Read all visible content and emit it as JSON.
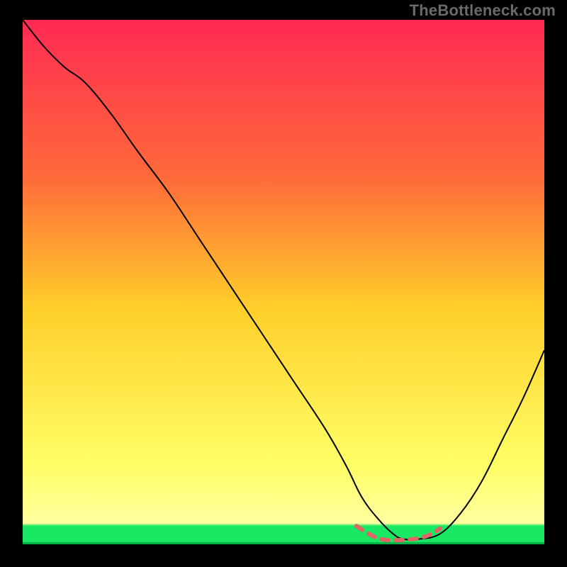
{
  "watermark": "TheBottleneck.com",
  "chart_data": {
    "type": "line",
    "title": "",
    "xlabel": "",
    "ylabel": "",
    "xlim": [
      0,
      100
    ],
    "ylim": [
      0,
      100
    ],
    "grid": false,
    "legend": false,
    "background_gradient": {
      "top": "#ff2a53",
      "mid_upper": "#ff6a3a",
      "mid": "#ffcf2a",
      "mid_lower": "#ffff66",
      "bottom_band": "#18e862",
      "bottom_line": "#00b44a"
    },
    "series": [
      {
        "name": "curve",
        "color": "#000000",
        "stroke_width": 2,
        "x": [
          0,
          4,
          8,
          12,
          17,
          22,
          28,
          34,
          40,
          46,
          52,
          58,
          62,
          65,
          68,
          71,
          73,
          76,
          80,
          84,
          88,
          92,
          96,
          100
        ],
        "y": [
          100,
          95,
          91,
          88,
          82,
          75,
          67,
          58,
          49,
          40,
          31,
          22,
          15,
          9,
          5,
          2,
          1,
          1,
          2,
          6,
          12,
          20,
          28,
          37
        ]
      },
      {
        "name": "dash-segment",
        "color": "#e06666",
        "stroke_width": 6,
        "dashed": true,
        "x": [
          64,
          66,
          68,
          70,
          72,
          74,
          76,
          78,
          80
        ],
        "y": [
          3.5,
          2.2,
          1.2,
          0.8,
          0.8,
          0.9,
          1.2,
          1.8,
          3
        ]
      }
    ]
  }
}
